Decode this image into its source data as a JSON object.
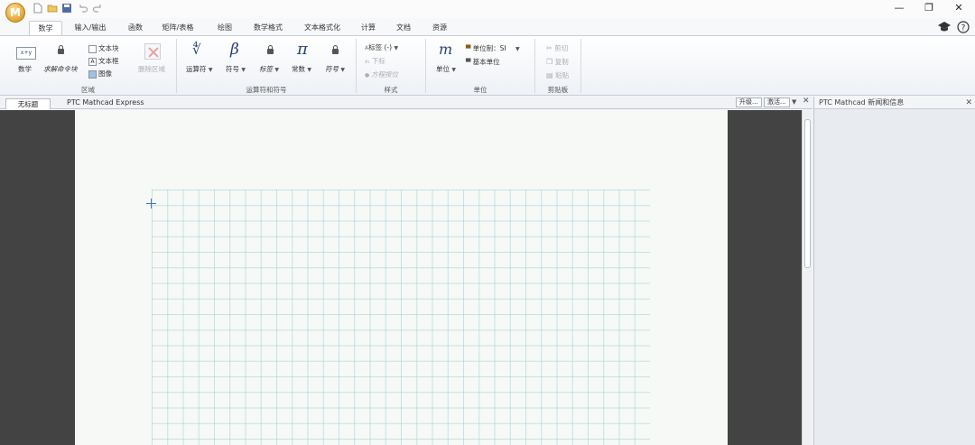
{
  "app": {
    "logo_letter": "M"
  },
  "window_controls": {
    "minimize": "—",
    "restore": "❐",
    "close": "✕"
  },
  "tabs": [
    {
      "label": "数学",
      "active": true
    },
    {
      "label": "输入/输出"
    },
    {
      "label": "函数"
    },
    {
      "label": "矩阵/表格"
    },
    {
      "label": "绘图"
    },
    {
      "label": "数学格式"
    },
    {
      "label": "文本格式化"
    },
    {
      "label": "计算"
    },
    {
      "label": "文档"
    },
    {
      "label": "资源"
    }
  ],
  "ribbon": {
    "region_group": {
      "math_label": "数学",
      "math_icon_text": "x+y",
      "solve_block_label": "求解命令块",
      "text_block_label": "文本块",
      "text_box_label": "文本框",
      "image_label": "图像",
      "delete_region_label": "删除区域",
      "group_label": "区域"
    },
    "operators_group": {
      "operators_label": "运算符",
      "symbols_label": "符号",
      "markup_label": "标签",
      "constants_label": "常数",
      "notation_label": "符号",
      "group_label": "运算符和符号"
    },
    "style_group": {
      "label_label": "标签 (-)",
      "subscript_label": "下标",
      "matrix_op_label": "方程按位",
      "group_label": "样式"
    },
    "units_group": {
      "units_label": "单位",
      "unit_system_label": "单位制：SI",
      "base_units_label": "基本单位",
      "group_label": "单位"
    },
    "clipboard_group": {
      "cut_label": "剪切",
      "copy_label": "复制",
      "paste_label": "粘贴",
      "group_label": "剪贴板"
    }
  },
  "document": {
    "tab_label": "无标题",
    "title": "PTC Mathcad Express",
    "upgrade_button": "升级...",
    "activate_button": "激活..."
  },
  "panel": {
    "title": "PTC Mathcad 新闻和信息",
    "close": "✕"
  }
}
